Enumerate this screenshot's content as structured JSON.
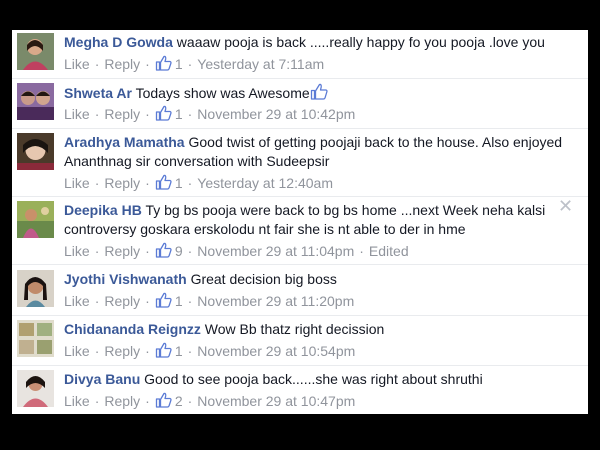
{
  "actions": {
    "like": "Like",
    "reply": "Reply",
    "separator": "·",
    "edited": "Edited"
  },
  "icons": {
    "like": "thumbs-up-icon",
    "close": "close-icon"
  },
  "colors": {
    "name": "#3b5998",
    "meta": "#90949c",
    "text": "#141823",
    "background": "#000000"
  },
  "comments": [
    {
      "name": "Megha D Gowda",
      "text": "waaaw pooja is back .....really happy fo you pooja .love you",
      "likes": "1",
      "time": "Yesterday at 7:11am"
    },
    {
      "name": "Shweta Ar",
      "text": "Todays show was Awesome",
      "likes": "1",
      "time": "November 29 at 10:42pm"
    },
    {
      "name": "Aradhya Mamatha",
      "text": "Good twist of getting poojaji back to the house. Also enjoyed Ananthnag sir conversation with Sudeepsir",
      "likes": "1",
      "time": "Yesterday at 12:40am"
    },
    {
      "name": "Deepika HB",
      "text": "Ty bg bs pooja were back to bg bs home ...next Week neha kalsi controversy goskara erskolodu nt fair she is nt able to der in hme",
      "likes": "9",
      "time": "November 29 at 11:04pm"
    },
    {
      "name": "Jyothi Vishwanath",
      "text": "Great decision big boss",
      "likes": "1",
      "time": "November 29 at 11:20pm"
    },
    {
      "name": "Chidananda Reignzz",
      "text": "Wow Bb thatz right decission",
      "likes": "1",
      "time": "November 29 at 10:54pm"
    },
    {
      "name": "Divya Banu",
      "text": "Good to see pooja back......she was right about shruthi",
      "likes": "2",
      "time": "November 29 at 10:47pm"
    }
  ]
}
